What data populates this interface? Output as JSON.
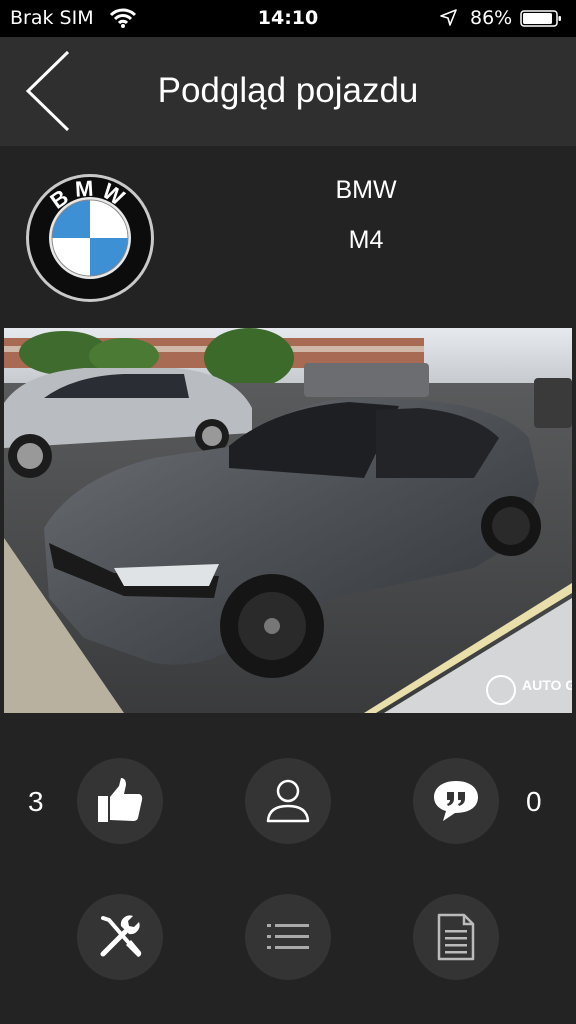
{
  "status_bar": {
    "carrier": "Brak SIM",
    "time": "14:10",
    "battery": "86%"
  },
  "header": {
    "title": "Podgląd pojazdu"
  },
  "vehicle": {
    "make": "BMW",
    "model": "M4"
  },
  "photo": {
    "watermark": "AUTO GESPOT"
  },
  "stats": {
    "likes": "3",
    "comments": "0"
  },
  "colors": {
    "background": "#232323",
    "navbar": "#2f2f2f",
    "button": "#343434"
  }
}
